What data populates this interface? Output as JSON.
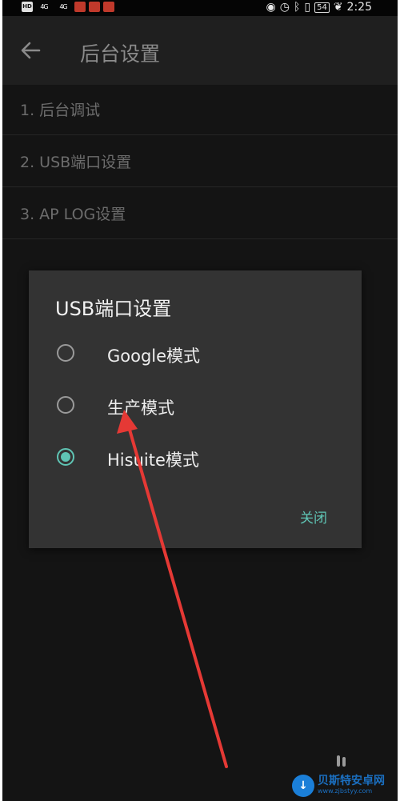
{
  "status_bar": {
    "left_icons": [
      "HD",
      "4G",
      "4G"
    ],
    "battery": "54",
    "time": "2:25"
  },
  "app_bar": {
    "title": "后台设置"
  },
  "list": {
    "items": [
      "1. 后台调试",
      "2. USB端口设置",
      "3. AP LOG设置"
    ]
  },
  "dialog": {
    "title": "USB端口设置",
    "options": [
      {
        "label": "Google模式",
        "selected": false
      },
      {
        "label": "生产模式",
        "selected": false
      },
      {
        "label": "Hisuite模式",
        "selected": true
      }
    ],
    "close_label": "关闭"
  },
  "accent_color": "#5fc4b4",
  "annotation": {
    "color": "#e53935"
  },
  "watermark": {
    "name": "贝斯特安卓网",
    "url": "www.zjbstyy.com"
  }
}
